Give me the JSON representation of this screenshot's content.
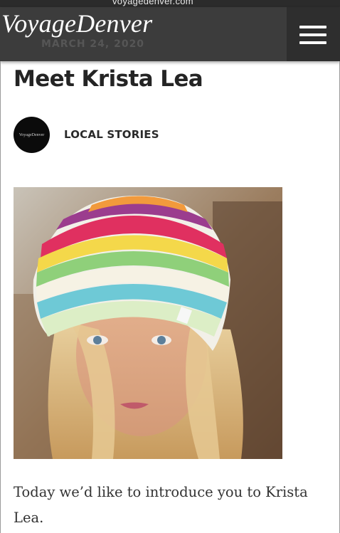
{
  "browser": {
    "url_fragment": "voyagedenver.com"
  },
  "header": {
    "logo": "VoyageDenver",
    "date_behind": "MARCH 24, 2020",
    "menu_icon": "hamburger-menu-icon"
  },
  "article": {
    "title": "Meet Krista Lea",
    "author_avatar_text": "VoyageDenver",
    "category": "LOCAL STORIES",
    "intro_line1": "Today we’d like to introduce you to Krista",
    "intro_line2": "Lea."
  },
  "colors": {
    "header_bg": "#3c3c3c",
    "menu_bg": "#2e2e2e",
    "title_text": "#242424"
  }
}
